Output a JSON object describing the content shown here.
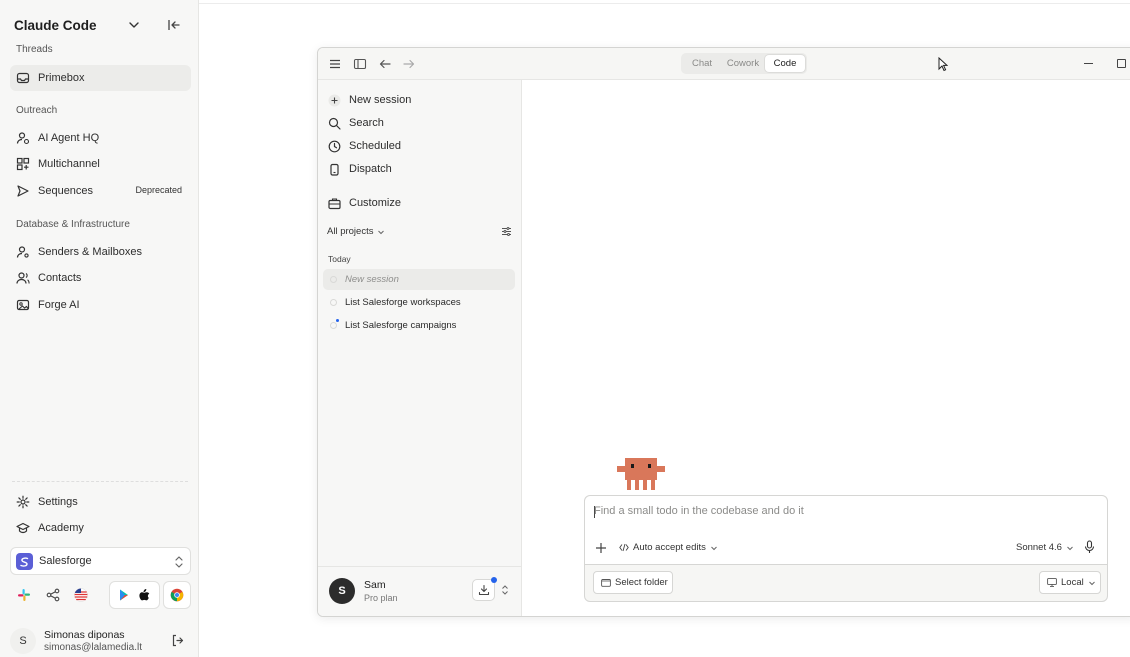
{
  "sidebar": {
    "title": "Claude Code",
    "sections": {
      "threads": "Threads",
      "outreach": "Outreach",
      "database": "Database & Infrastructure"
    },
    "items": {
      "primebox": "Primebox",
      "ai_agent_hq": "AI Agent HQ",
      "multichannel": "Multichannel",
      "sequences": "Sequences",
      "sequences_badge": "Deprecated",
      "senders": "Senders & Mailboxes",
      "contacts": "Contacts",
      "forge_ai": "Forge AI",
      "settings": "Settings",
      "academy": "Academy"
    },
    "org_select": "Salesforge",
    "user": {
      "initial": "S",
      "name": "Simonas diponas",
      "email": "simonas@lalamedia.lt"
    }
  },
  "window": {
    "tabs": [
      "Chat",
      "Cowork",
      "Code"
    ],
    "active_tab": "Code",
    "nav": {
      "new_session": "New session",
      "search": "Search",
      "scheduled": "Scheduled",
      "dispatch": "Dispatch",
      "customize": "Customize"
    },
    "projects_filter": "All projects",
    "group_label": "Today",
    "sessions": [
      "New session",
      "List Salesforge workspaces",
      "List Salesforge campaigns"
    ],
    "user": {
      "initial": "S",
      "name": "Sam",
      "plan": "Pro plan"
    },
    "composer": {
      "placeholder": "Find a small todo in the codebase and do it",
      "mode": "Auto accept edits",
      "model": "Sonnet 4.6",
      "select_folder": "Select folder",
      "environment": "Local"
    }
  },
  "colors": {
    "accent_blue": "#2563eb",
    "mascot": "#d9775a",
    "salesforge": "#5b5fd6"
  }
}
